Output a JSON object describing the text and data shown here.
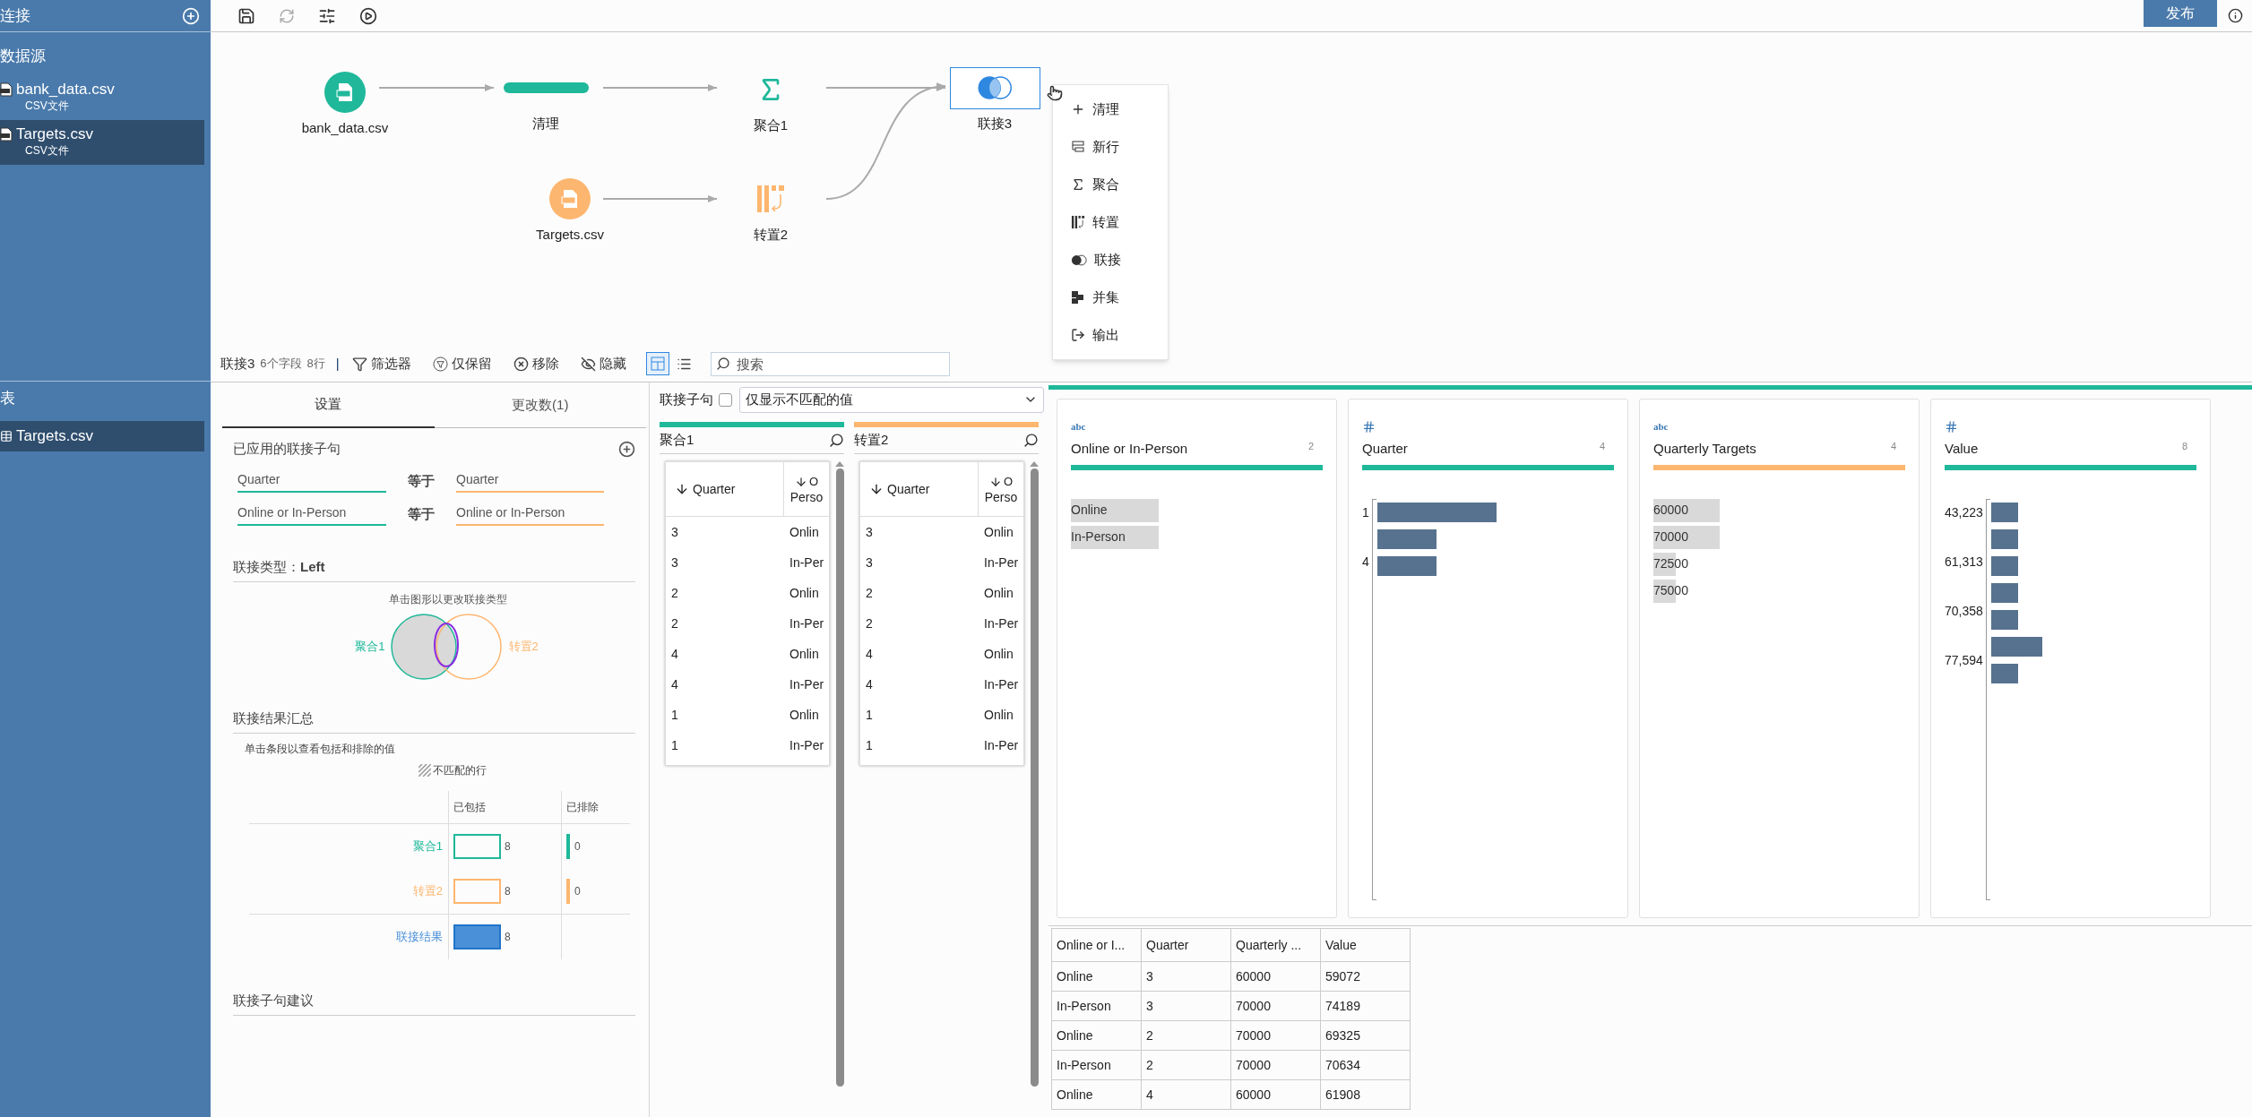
{
  "sidebar": {
    "header": "连接",
    "sources_title": "数据源",
    "sources": [
      {
        "name": "bank_data.csv",
        "type": "CSV文件",
        "selected": false
      },
      {
        "name": "Targets.csv",
        "type": "CSV文件",
        "selected": true
      }
    ],
    "tables_title": "表",
    "tables": [
      {
        "name": "Targets.csv",
        "selected": true
      }
    ]
  },
  "toolbar": {
    "publish": "发布"
  },
  "flow": {
    "nodes": [
      {
        "label": "bank_data.csv",
        "kind": "csv",
        "color": "#1fb89a",
        "selected": false
      },
      {
        "label": "清理",
        "kind": "clean",
        "selected": false
      },
      {
        "label": "聚合1",
        "kind": "aggregate",
        "selected": false
      },
      {
        "label": "联接3",
        "kind": "join",
        "selected": true
      },
      {
        "label": "Targets.csv",
        "kind": "csv",
        "color": "#fdb66f",
        "selected": false
      },
      {
        "label": "转置2",
        "kind": "pivot",
        "selected": false
      }
    ],
    "menu": [
      {
        "kind": "clean",
        "label": "清理"
      },
      {
        "kind": "new_rows",
        "label": "新行"
      },
      {
        "kind": "aggregate",
        "label": "聚合"
      },
      {
        "kind": "pivot",
        "label": "转置"
      },
      {
        "kind": "join",
        "label": "联接"
      },
      {
        "kind": "union",
        "label": "并集"
      },
      {
        "kind": "output",
        "label": "输出"
      }
    ]
  },
  "step_bar": {
    "name": "联接3",
    "fields": "6个字段",
    "rows": "8行",
    "separator": "|",
    "actions": [
      {
        "kind": "filter",
        "label": "筛选器"
      },
      {
        "kind": "keep",
        "label": "仅保留"
      },
      {
        "kind": "remove",
        "label": "移除"
      },
      {
        "kind": "hide",
        "label": "隐藏"
      }
    ],
    "views": [
      {
        "kind": "cards",
        "selected": true
      },
      {
        "kind": "list",
        "selected": false
      }
    ],
    "search": {
      "placeholder": "搜索"
    }
  },
  "settings": {
    "tabs": [
      {
        "label": "设置",
        "selected": true
      },
      {
        "label": "更改数(1)",
        "selected": false
      }
    ],
    "clauses_title": "已应用的联接子句",
    "clauses": [
      {
        "left": "Quarter",
        "op": "等于",
        "right": "Quarter"
      },
      {
        "left": "Online or In-Person",
        "op": "等于",
        "right": "Online or In-Person"
      }
    ],
    "join_type": "联接类型：**Left**",
    "venn_hint": "单击图形以更改联接类型",
    "venn_left": "聚合1",
    "venn_right": "转置2",
    "summary_title": "联接结果汇总",
    "summary_hint": "单击条段以查看包括和排除的值",
    "legend": "不匹配的行",
    "columns": [
      "已包括",
      "已排除"
    ],
    "rows": [
      {
        "kind": "input",
        "label": "聚合1",
        "color": "#1fb89a",
        "included": "8",
        "excluded": "0"
      },
      {
        "kind": "input",
        "label": "转置2",
        "color": "#fdb66f",
        "included": "8",
        "excluded": "0"
      },
      {
        "kind": "result",
        "label": "联接结果",
        "color": "#4a90d9",
        "included": "8"
      }
    ],
    "suggestions_title": "联接子句建议"
  },
  "clause_view": {
    "label": "联接子句",
    "unmatched_only": false,
    "dropdown": "仅显示不匹配的值",
    "inputs": [
      {
        "title": "聚合1",
        "color": "#1fb89a",
        "col1": "Quarter",
        "col2": [
          "O",
          "Perso"
        ],
        "rows": [
          [
            "3",
            "Onlin"
          ],
          [
            "3",
            "In-Per"
          ],
          [
            "2",
            "Onlin"
          ],
          [
            "2",
            "In-Per"
          ],
          [
            "4",
            "Onlin"
          ],
          [
            "4",
            "In-Per"
          ],
          [
            "1",
            "Onlin"
          ],
          [
            "1",
            "In-Per"
          ]
        ]
      },
      {
        "title": "转置2",
        "color": "#fdb66f",
        "col1": "Quarter",
        "col2": [
          "O",
          "Perso"
        ],
        "rows": [
          [
            "3",
            "Onlin"
          ],
          [
            "3",
            "In-Per"
          ],
          [
            "2",
            "Onlin"
          ],
          [
            "2",
            "In-Per"
          ],
          [
            "4",
            "Onlin"
          ],
          [
            "4",
            "In-Per"
          ],
          [
            "1",
            "Onlin"
          ],
          [
            "1",
            "In-Per"
          ]
        ]
      }
    ]
  },
  "profile": {
    "cards": [
      {
        "type": {
          "kind": "text",
          "label": "abc"
        },
        "title": "Online or In-Person",
        "count": "2",
        "color": "#1fb89a",
        "kind": "values",
        "values": [
          "Online",
          "In-Person"
        ]
      },
      {
        "type": {
          "kind": "number"
        },
        "title": "Quarter",
        "count": "4",
        "color": "#1fb89a",
        "kind": "histogram",
        "ticks": [
          "1",
          "4"
        ]
      },
      {
        "type": {
          "kind": "text",
          "label": "abc"
        },
        "title": "Quarterly Targets",
        "count": "4",
        "color": "#fdb66f",
        "kind": "values",
        "values": [
          "60000",
          "70000",
          "72500",
          "75000"
        ]
      },
      {
        "type": {
          "kind": "number"
        },
        "title": "Value",
        "count": "8",
        "color": "#1fb89a",
        "kind": "histogram",
        "ticks": [
          "43,223",
          "61,313",
          "70,358",
          "77,594"
        ]
      }
    ]
  },
  "table": {
    "columns": [
      "Online or I...",
      "Quarter",
      "Quarterly ...",
      "Value"
    ],
    "rows": [
      [
        "Online",
        "3",
        "60000",
        "59072"
      ],
      [
        "In-Person",
        "3",
        "70000",
        "74189"
      ],
      [
        "Online",
        "2",
        "70000",
        "69325"
      ],
      [
        "In-Person",
        "2",
        "70000",
        "70634"
      ],
      [
        "Online",
        "4",
        "60000",
        "61908"
      ]
    ]
  }
}
